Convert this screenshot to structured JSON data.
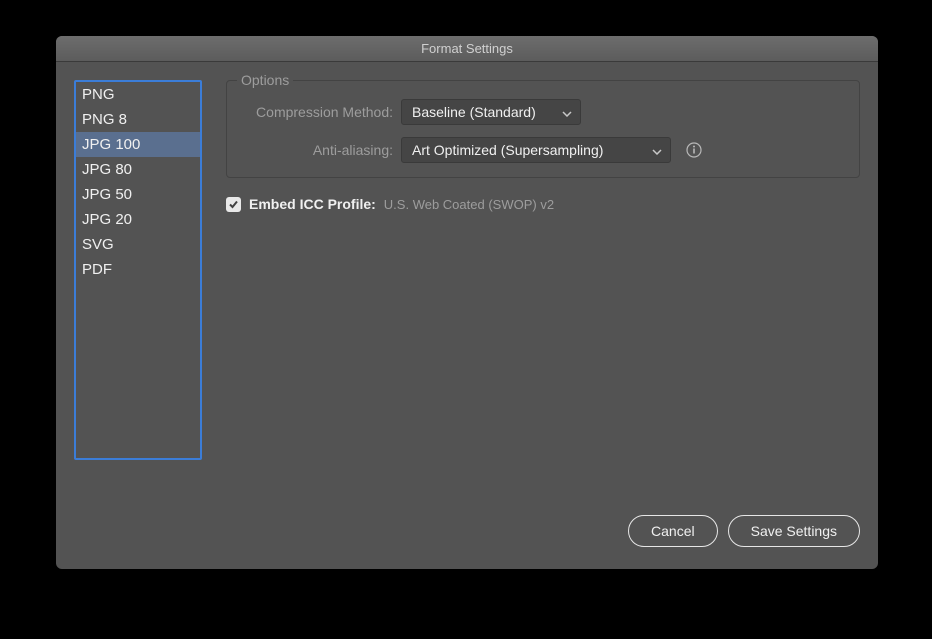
{
  "title": "Format Settings",
  "formats": [
    "PNG",
    "PNG 8",
    "JPG 100",
    "JPG 80",
    "JPG 50",
    "JPG 20",
    "SVG",
    "PDF"
  ],
  "selected_format_index": 2,
  "options": {
    "legend": "Options",
    "compression": {
      "label": "Compression Method:",
      "value": "Baseline (Standard)"
    },
    "antialiasing": {
      "label": "Anti-aliasing:",
      "value": "Art Optimized (Supersampling)"
    }
  },
  "embed": {
    "checked": true,
    "label": "Embed ICC Profile:",
    "value": "U.S. Web Coated (SWOP) v2"
  },
  "buttons": {
    "cancel": "Cancel",
    "save": "Save Settings"
  }
}
